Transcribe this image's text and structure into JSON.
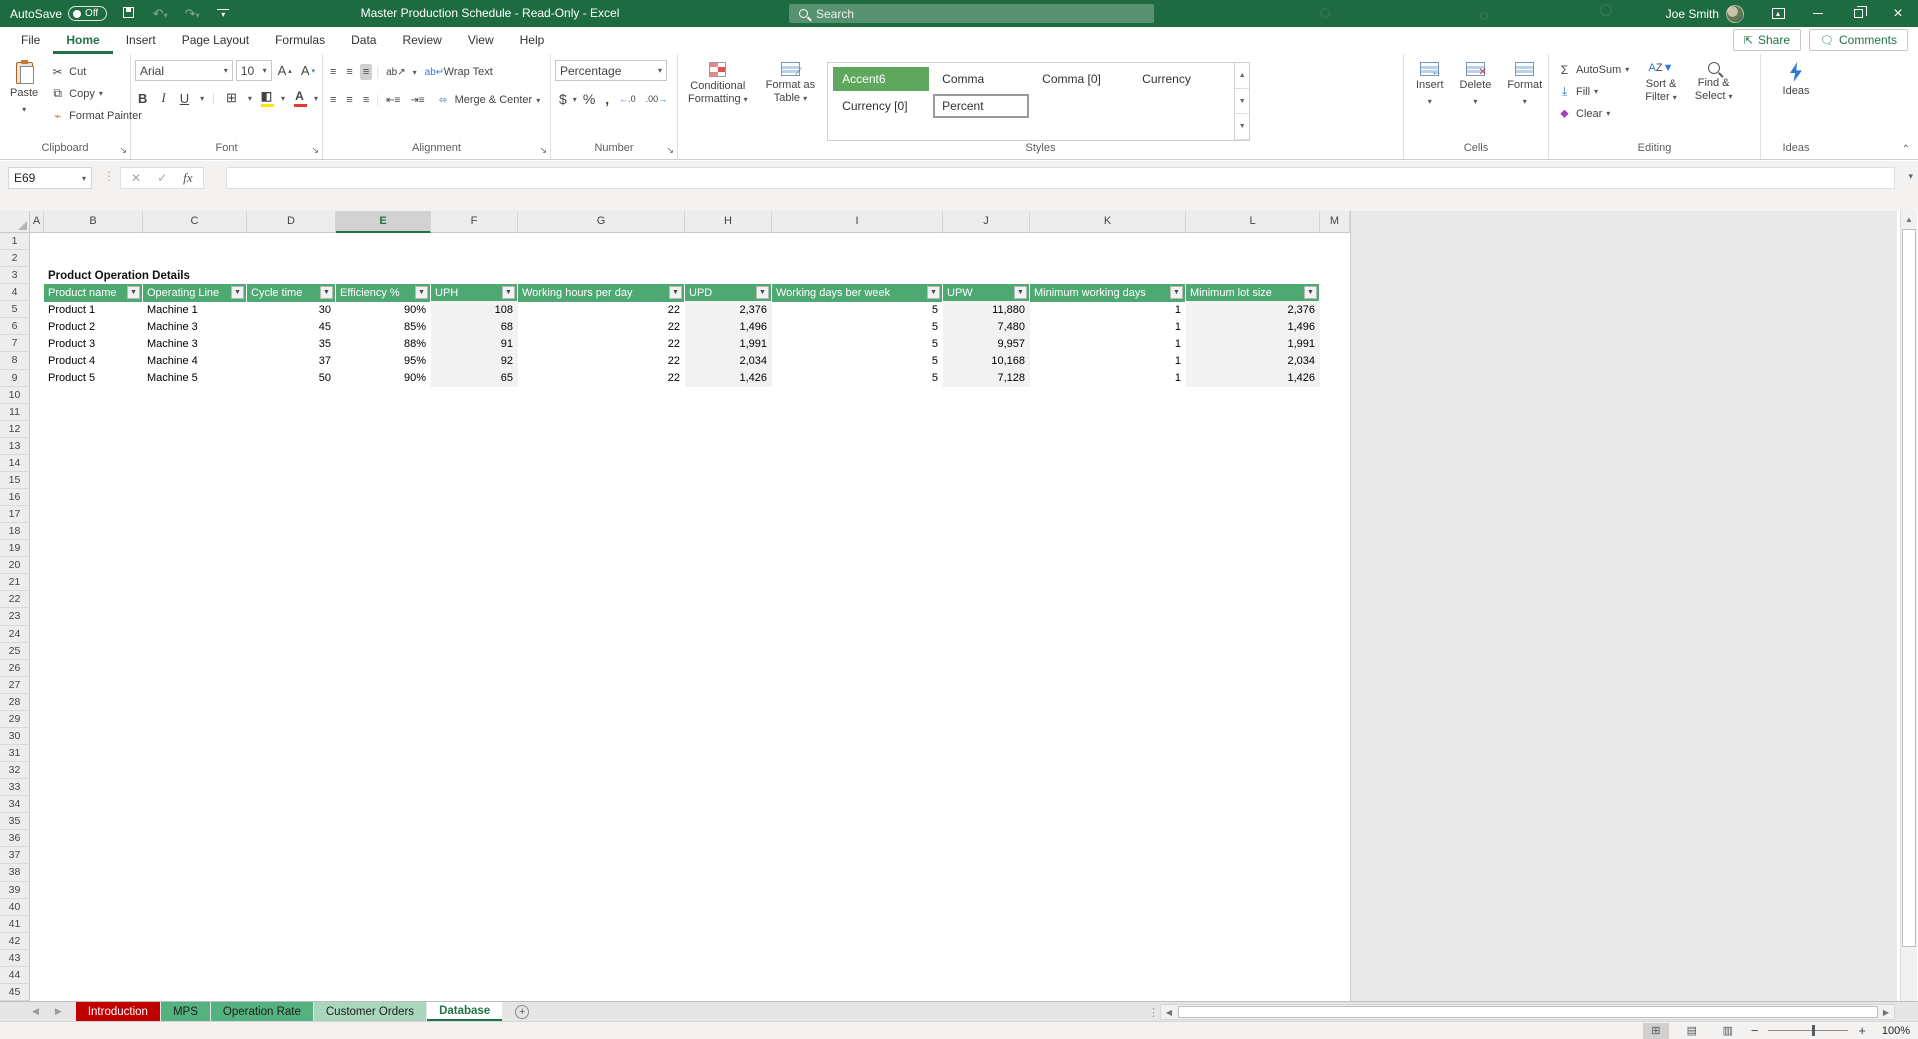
{
  "colors": {
    "titlebar_green": "#1E6B41",
    "excel_green": "#217346",
    "table_header_green": "#4EA872",
    "accent6_chip_green": "#5FA75E",
    "shaded_column_gray": "#F2F2F2",
    "tab_red": "#C00000",
    "tab_green": "#53B27F",
    "tab_green_light": "#A9D7BD",
    "fill_yellow": "#FFE600",
    "font_color_red": "#E03C31",
    "ideas_blue": "#2B7CD3"
  },
  "titlebar": {
    "autosave_label": "AutoSave",
    "autosave_state": "Off",
    "title": "Master Production Schedule  -  Read-Only  -  Excel",
    "search_placeholder": "Search",
    "user_name": "Joe Smith"
  },
  "menubar": {
    "tabs": [
      "File",
      "Home",
      "Insert",
      "Page Layout",
      "Formulas",
      "Data",
      "Review",
      "View",
      "Help"
    ],
    "active_tab": "Home",
    "share": "Share",
    "comments": "Comments"
  },
  "ribbon": {
    "clipboard": {
      "label": "Clipboard",
      "paste": "Paste",
      "cut": "Cut",
      "copy": "Copy",
      "format_painter": "Format Painter"
    },
    "font": {
      "label": "Font",
      "family": "Arial",
      "size": "10"
    },
    "alignment": {
      "label": "Alignment",
      "wrap": "Wrap Text",
      "merge": "Merge & Center"
    },
    "number": {
      "label": "Number",
      "format": "Percentage"
    },
    "styles": {
      "label": "Styles",
      "conditional_line1": "Conditional",
      "conditional_line2": "Formatting",
      "format_table_line1": "Format as",
      "format_table_line2": "Table",
      "gallery": [
        "Accent6",
        "Comma",
        "Comma [0]",
        "Currency",
        "Currency [0]",
        "Percent"
      ],
      "highlighted_style": "Accent6",
      "selected_style": "Percent"
    },
    "cells": {
      "label": "Cells",
      "insert": "Insert",
      "delete": "Delete",
      "format": "Format"
    },
    "editing": {
      "label": "Editing",
      "autosum": "AutoSum",
      "fill": "Fill",
      "clear": "Clear",
      "sort_line1": "Sort &",
      "sort_line2": "Filter",
      "find_line1": "Find &",
      "find_line2": "Select"
    },
    "ideas": {
      "label": "Ideas",
      "button": "Ideas"
    }
  },
  "formula_bar": {
    "name_box": "E69",
    "formula": ""
  },
  "sheet": {
    "columns": [
      "A",
      "B",
      "C",
      "D",
      "E",
      "F",
      "G",
      "H",
      "I",
      "J",
      "K",
      "L",
      "M"
    ],
    "selected_column": "E",
    "row_count": 45,
    "title_cell": "Product Operation Details",
    "table": {
      "headers": [
        "Product name",
        "Operating Line",
        "Cycle time",
        "Efficiency %",
        "UPH",
        "Working hours per day",
        "UPD",
        "Working days ber week",
        "UPW",
        "Minimum working days",
        "Minimum lot size"
      ],
      "shaded_headers": [
        "UPH",
        "UPD",
        "UPW",
        "Minimum lot size"
      ],
      "rows": [
        [
          "Product 1",
          "Machine 1",
          "30",
          "90%",
          "108",
          "22",
          "2,376",
          "5",
          "11,880",
          "1",
          "2,376"
        ],
        [
          "Product 2",
          "Machine 3",
          "45",
          "85%",
          "68",
          "22",
          "1,496",
          "5",
          "7,480",
          "1",
          "1,496"
        ],
        [
          "Product 3",
          "Machine 3",
          "35",
          "88%",
          "91",
          "22",
          "1,991",
          "5",
          "9,957",
          "1",
          "1,991"
        ],
        [
          "Product 4",
          "Machine 4",
          "37",
          "95%",
          "92",
          "22",
          "2,034",
          "5",
          "10,168",
          "1",
          "2,034"
        ],
        [
          "Product 5",
          "Machine 5",
          "50",
          "90%",
          "65",
          "22",
          "1,426",
          "5",
          "7,128",
          "1",
          "1,426"
        ]
      ]
    }
  },
  "sheet_tabs": {
    "active": "Database",
    "tabs": [
      {
        "label": "Introduction",
        "color": "#C00000",
        "text_color": "#FFFFFF"
      },
      {
        "label": "MPS",
        "color": "#53B27F",
        "text_color": "#1D1D1D"
      },
      {
        "label": "Operation Rate",
        "color": "#53B27F",
        "text_color": "#1D1D1D"
      },
      {
        "label": "Customer Orders",
        "color": "#A9D7BD",
        "text_color": "#1D1D1D"
      },
      {
        "label": "Database",
        "color": "#FFFFFF",
        "text_color": "#217346"
      }
    ]
  },
  "status_bar": {
    "zoom_level": "100%"
  }
}
